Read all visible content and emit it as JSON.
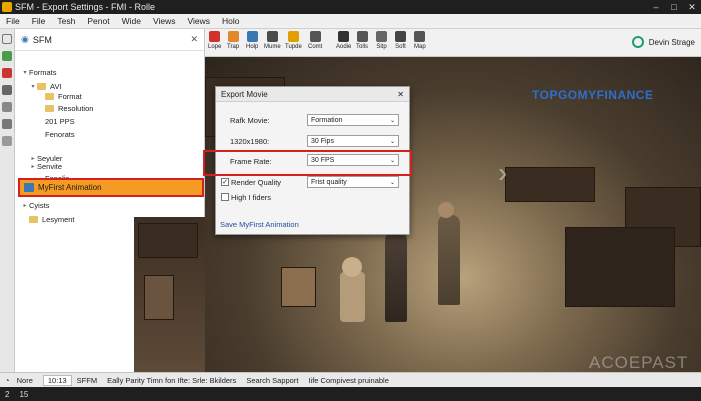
{
  "window": {
    "title": "SFM - Export Settings - FMI - Rolle",
    "controls": [
      "–",
      "□",
      "✕"
    ]
  },
  "menu": [
    "File",
    "File",
    "Tesh",
    "Penot",
    "Wide",
    "Views",
    "Views",
    "Holo"
  ],
  "tree": {
    "title": "SFM",
    "rows": [
      {
        "label": "Formats",
        "expand": "▾",
        "folder": false
      },
      {
        "label": "AVI",
        "expand": "▾",
        "folder": true
      },
      {
        "label": "Format",
        "expand": "",
        "folder": true
      },
      {
        "label": "Resolution",
        "expand": "",
        "folder": true
      },
      {
        "label": "201 PPS",
        "expand": "",
        "folder": false
      },
      {
        "label": "Fenorats",
        "expand": "",
        "folder": false
      },
      {
        "label": "Seyuler",
        "expand": "▸",
        "folder": false
      },
      {
        "label": "Senvite",
        "expand": "▸",
        "folder": false
      },
      {
        "label": "Fapelis",
        "expand": "",
        "folder": false
      }
    ],
    "selected": "MyFirst Animation",
    "after": [
      {
        "label": "Cyists",
        "expand": "▸",
        "folder": false
      },
      {
        "label": "Lesyment",
        "expand": "",
        "folder": true
      }
    ]
  },
  "toolbar": {
    "tools": [
      {
        "label": "Lope",
        "icon": "layers-icon",
        "color": "#d0312d"
      },
      {
        "label": "Trap",
        "icon": "trap-icon",
        "color": "#e3872b"
      },
      {
        "label": "Holp",
        "icon": "help-icon",
        "color": "#3a78b5"
      },
      {
        "label": "Mume",
        "icon": "mume-icon",
        "color": "#4b4b4b"
      },
      {
        "label": "Tupde",
        "icon": "tupde-icon",
        "color": "#e0a000"
      },
      {
        "label": "Comt",
        "icon": "comt-icon",
        "color": "#555555"
      },
      {
        "label": "Aodie",
        "icon": "audio-icon",
        "color": "#333333"
      },
      {
        "label": "Tolls",
        "icon": "tools-icon",
        "color": "#555555"
      },
      {
        "label": "Sitp",
        "icon": "sitp-icon",
        "color": "#666666"
      },
      {
        "label": "Soft",
        "icon": "soft-icon",
        "color": "#444444"
      },
      {
        "label": "Map",
        "icon": "map-icon",
        "color": "#555555"
      }
    ],
    "account_name": "Devin Strage"
  },
  "viewport": {
    "brand": "TOPGOMYFINANCE",
    "watermark": "ACOEPAST"
  },
  "dialog": {
    "title": "Export Movie",
    "rows": [
      {
        "label": "Rafk Movie:",
        "value": "Formation"
      },
      {
        "label": "1320x1980:",
        "value": "30 Fips"
      },
      {
        "label": "Frame Rate:",
        "value": "30 FPS"
      }
    ],
    "render_quality": {
      "label": "Render Quality",
      "checked": true,
      "value": "Frist quality"
    },
    "high_fiders": {
      "label": "High I fiders",
      "checked": false
    },
    "save_label": "Save MyFirst Animation"
  },
  "status": [
    "Nore",
    "10:13",
    "SFFM",
    "Eally Parity Timn fon Ifte: Srle: Bkilders",
    "Search Sapport",
    "Iife Compivest pruinable"
  ],
  "bottom": [
    "2",
    "15"
  ]
}
